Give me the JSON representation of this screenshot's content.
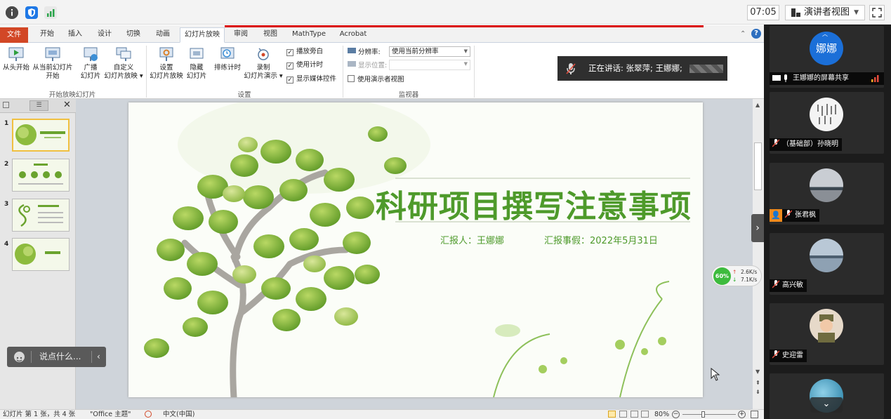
{
  "meeting": {
    "time": "07:05",
    "presenter_view": "演讲者视图"
  },
  "ribbon": {
    "file_tab": "文件",
    "tabs": [
      "开始",
      "插入",
      "设计",
      "切换",
      "动画",
      "幻灯片放映",
      "审阅",
      "视图",
      "MathType",
      "Acrobat"
    ],
    "buttons": {
      "from_start": "从头开始",
      "from_current_l1": "从当前幻灯片",
      "from_current_l2": "开始",
      "broadcast_l1": "广播",
      "broadcast_l2": "幻灯片",
      "custom_l1": "自定义",
      "custom_l2": "幻灯片放映",
      "setup_l1": "设置",
      "setup_l2": "幻灯片放映",
      "hide_l1": "隐藏",
      "hide_l2": "幻灯片",
      "rehearse": "排练计时",
      "record_l1": "录制",
      "record_l2": "幻灯片演示"
    },
    "checks": {
      "play_narration": "播放旁白",
      "use_timing": "使用计时",
      "show_media": "显示媒体控件",
      "presenter_view": "使用演示者视图"
    },
    "monitors": {
      "resolution_label": "分辨率:",
      "resolution_value": "使用当前分辨率",
      "display_label": "显示位置:"
    },
    "groups": {
      "start": "开始放映幻灯片",
      "setup": "设置",
      "monitor": "监视器"
    }
  },
  "speaking": "正在讲话: 张翠萍; 王娜娜;",
  "slide": {
    "title": "科研项目撰写注意事项",
    "reporter": "汇报人：王娜娜",
    "date": "汇报事假：2022年5月31日"
  },
  "thumbnails": [
    "1",
    "2",
    "3",
    "4"
  ],
  "chat_placeholder": "说点什么...",
  "network": {
    "percent": "60%",
    "up": "2.6K/s",
    "down": "7.1K/s"
  },
  "status": {
    "slide_info": "幻灯片 第 1 张，共 4 张",
    "theme": "\"Office 主题\"",
    "lang": "中文(中国)",
    "zoom": "80%"
  },
  "participants": [
    {
      "name": "王娜娜的屏幕共享",
      "avatar_text": "娜娜",
      "color": "#1b6fd8"
    },
    {
      "name": "（基础部）孙晓明"
    },
    {
      "name": "张君枫"
    },
    {
      "name": "高兴敏"
    },
    {
      "name": "史迎雷"
    },
    {
      "name": ""
    }
  ],
  "colors": {
    "accent_red": "#d90000",
    "file_tab": "#d24726",
    "title_green": "#4e9a2b",
    "panel_bg": "#1c1c1c"
  }
}
